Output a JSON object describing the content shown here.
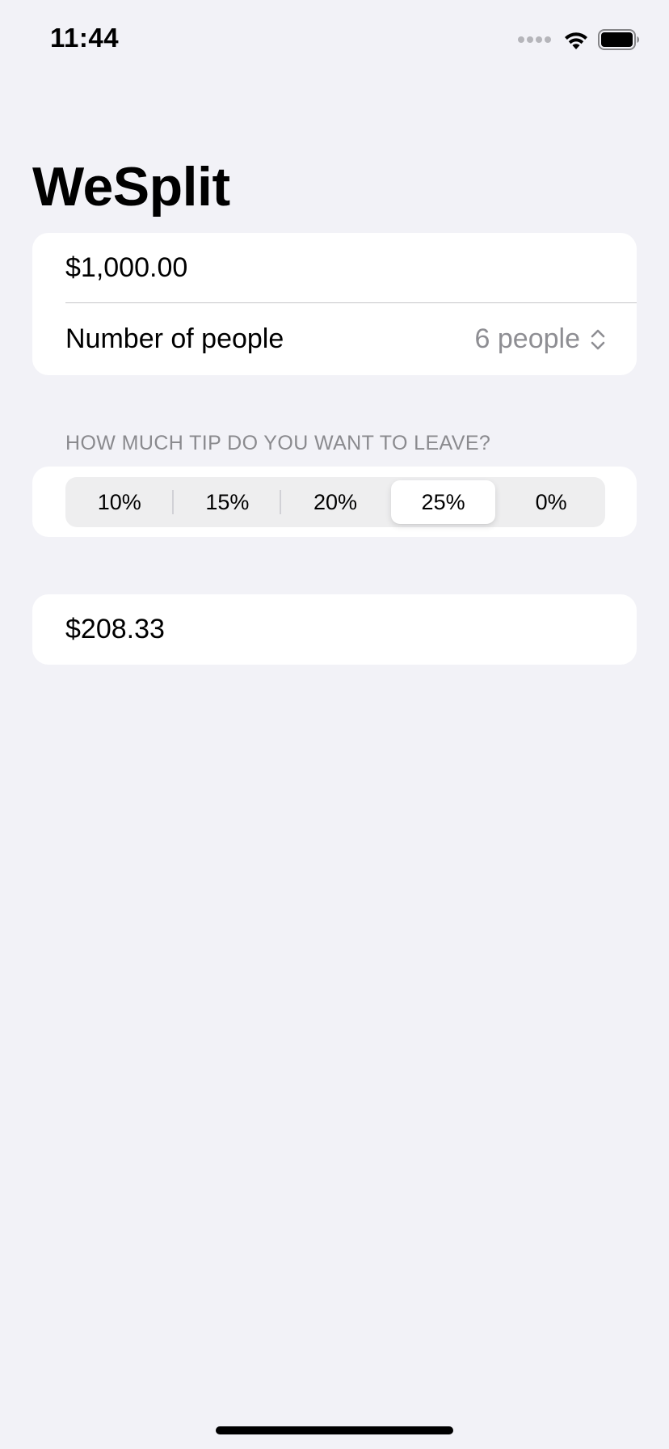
{
  "status_bar": {
    "time": "11:44"
  },
  "app": {
    "title": "WeSplit"
  },
  "form": {
    "amount_value": "$1,000.00",
    "people_label": "Number of people",
    "people_value": "6 people"
  },
  "tip_section": {
    "header": "HOW MUCH TIP DO YOU WANT TO LEAVE?",
    "options": [
      "10%",
      "15%",
      "20%",
      "25%",
      "0%"
    ],
    "selected": "25%"
  },
  "total": {
    "per_person": "$208.33"
  },
  "icons": {
    "wifi": "wifi-icon",
    "battery": "battery-icon",
    "cellular": "cellular-icon",
    "picker": "chevron-updown-icon"
  },
  "colors": {
    "background": "#f2f2f7",
    "secondary_text": "#8e8e93",
    "card": "#ffffff"
  }
}
